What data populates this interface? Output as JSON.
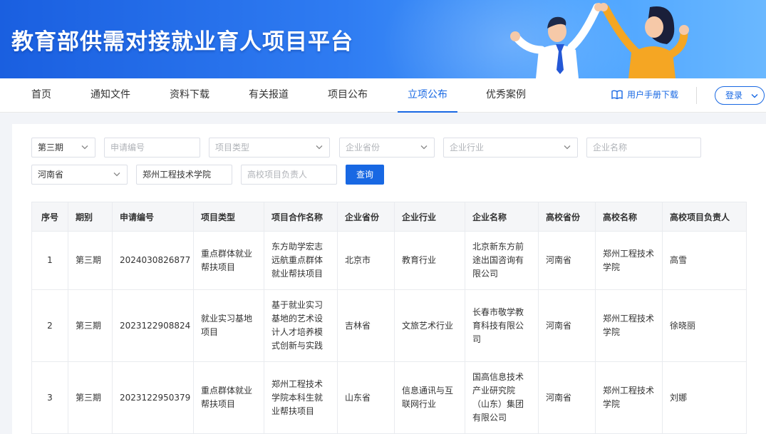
{
  "banner": {
    "title": "教育部供需对接就业育人项目平台"
  },
  "nav": {
    "items": [
      "首页",
      "通知文件",
      "资料下载",
      "有关报道",
      "项目公布",
      "立项公布",
      "优秀案例"
    ],
    "active_index": 5,
    "manual_label": "用户手册下载",
    "login_label": "登录"
  },
  "filters": {
    "period": "第三期",
    "apply_no_placeholder": "申请编号",
    "project_type_placeholder": "项目类型",
    "enterprise_province_placeholder": "企业省份",
    "enterprise_industry_placeholder": "企业行业",
    "enterprise_name_placeholder": "企业名称",
    "school_province": "河南省",
    "school_name": "郑州工程技术学院",
    "leader_placeholder": "高校项目负责人",
    "query_label": "查询"
  },
  "table": {
    "headers": [
      "序号",
      "期别",
      "申请编号",
      "项目类型",
      "项目合作名称",
      "企业省份",
      "企业行业",
      "企业名称",
      "高校省份",
      "高校名称",
      "高校项目负责人"
    ],
    "rows": [
      [
        "1",
        "第三期",
        "2024030826877",
        "重点群体就业帮扶项目",
        "东方助学宏志远航重点群体就业帮扶项目",
        "北京市",
        "教育行业",
        "北京新东方前途出国咨询有限公司",
        "河南省",
        "郑州工程技术学院",
        "高雪"
      ],
      [
        "2",
        "第三期",
        "2023122908824",
        "就业实习基地项目",
        "基于就业实习基地的艺术设计人才培养模式创新与实践",
        "吉林省",
        "文旅艺术行业",
        "长春市敬学教育科技有限公司",
        "河南省",
        "郑州工程技术学院",
        "徐晓丽"
      ],
      [
        "3",
        "第三期",
        "2023122950379",
        "重点群体就业帮扶项目",
        "郑州工程技术学院本科生就业帮扶项目",
        "山东省",
        "信息通讯与互联网行业",
        "国高信息技术产业研究院（山东）集团有限公司",
        "河南省",
        "郑州工程技术学院",
        "刘娜"
      ]
    ]
  },
  "colors": {
    "primary": "#1868e3",
    "banner_start": "#1a5fe0",
    "banner_end": "#6ab8ff"
  }
}
